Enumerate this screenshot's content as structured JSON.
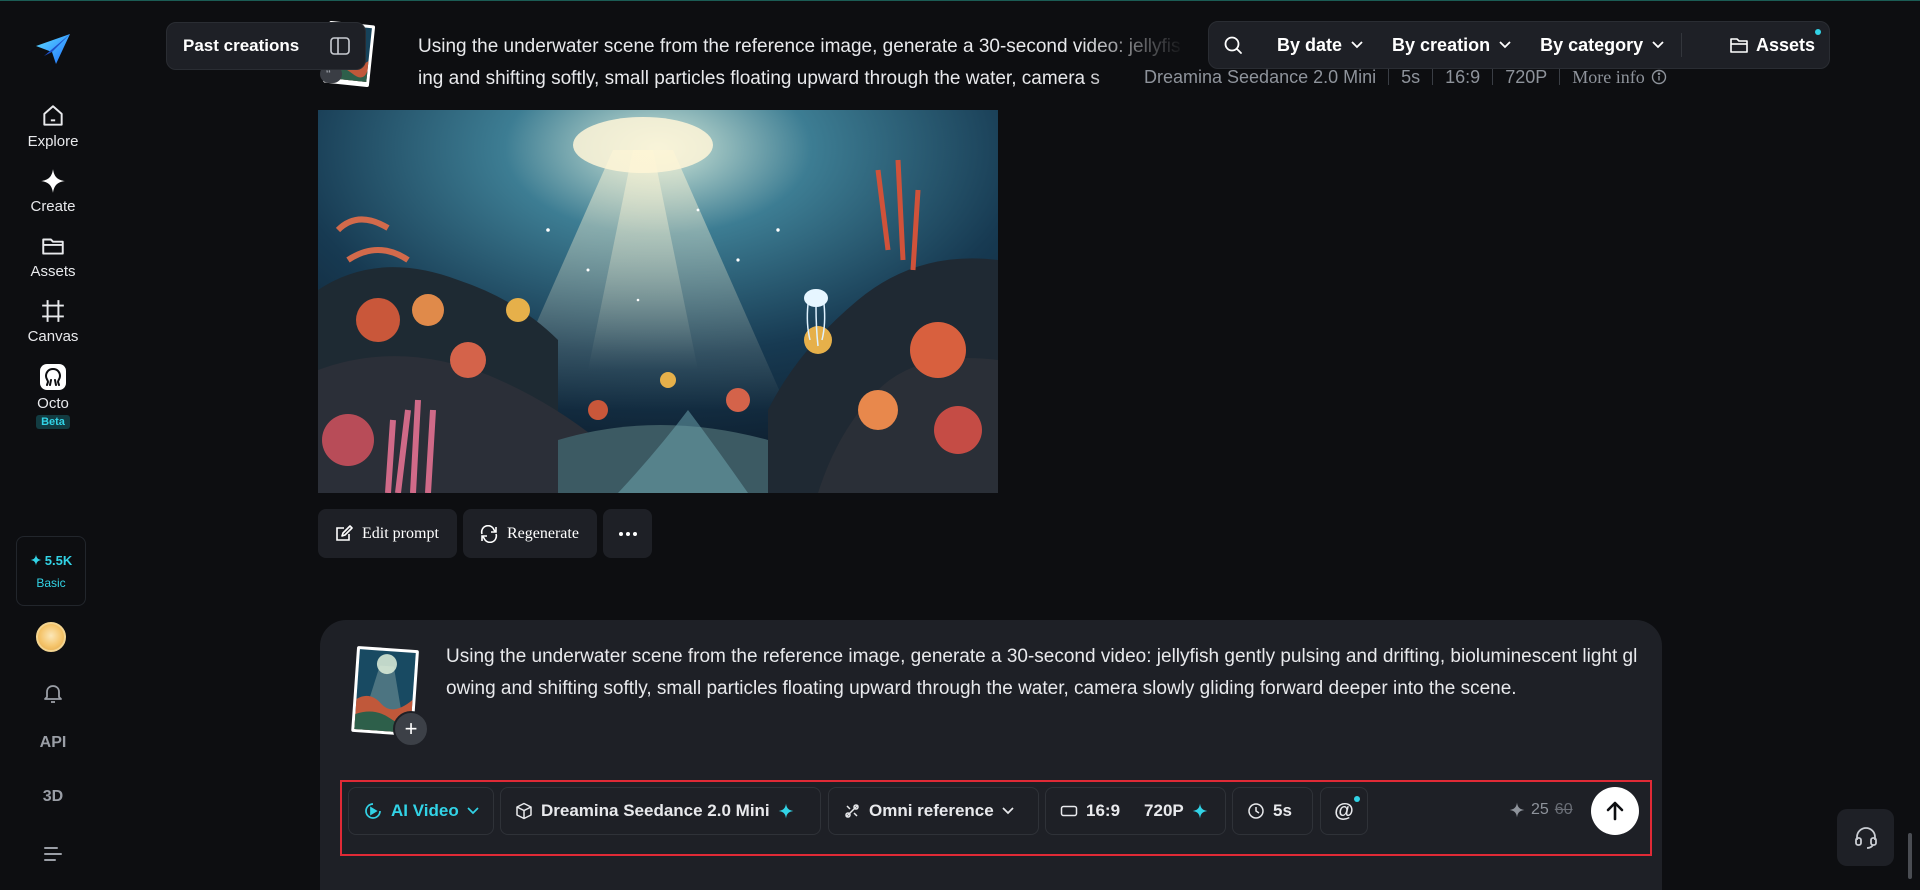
{
  "sidebar": {
    "items": [
      {
        "label": "Explore",
        "icon": "home-icon"
      },
      {
        "label": "Create",
        "icon": "sparkle-icon"
      },
      {
        "label": "Assets",
        "icon": "folder-icon"
      },
      {
        "label": "Canvas",
        "icon": "canvas-icon"
      },
      {
        "label": "Octo",
        "icon": "octo-icon"
      }
    ],
    "octo_badge": "Beta",
    "credits": {
      "value": "5.5K",
      "tier": "Basic"
    },
    "api_label": "API",
    "three_d_label": "3D"
  },
  "header": {
    "past_creations_label": "Past creations",
    "filters": [
      "By date",
      "By creation",
      "By category"
    ],
    "assets_label": "Assets"
  },
  "history_item": {
    "prompt_line1": "Using the underwater scene from the reference image, generate a 30-second video: jellyfis",
    "prompt_line2": "ing and shifting softly, small particles floating upward through the water, camera s",
    "meta": {
      "model": "Dreamina Seedance 2.0 Mini",
      "duration": "5s",
      "ratio": "16:9",
      "resolution": "720P",
      "more_info": "More info"
    },
    "actions": {
      "edit_prompt": "Edit prompt",
      "regenerate": "Regenerate"
    }
  },
  "composer": {
    "prompt": "Using the underwater scene from the reference image, generate a 30-second video: jellyfish gently pulsing and drifting, bioluminescent light glowing and shifting softly, small particles floating upward through the water, camera slowly gliding forward deeper into the scene.",
    "add_label": "+",
    "mode": "AI Video",
    "model": "Dreamina Seedance 2.0 Mini",
    "reference": "Omni reference",
    "ratio": "16:9",
    "resolution": "720P",
    "duration": "5s",
    "mention": "@",
    "cost": {
      "current": "25",
      "original": "60"
    }
  },
  "colors": {
    "accent": "#32d3e6",
    "highlight_outline": "#e02a36",
    "panel": "#1e2026",
    "background": "#0d0e11"
  }
}
